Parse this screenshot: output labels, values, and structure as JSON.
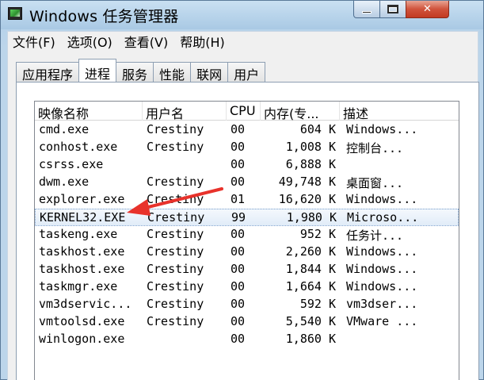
{
  "window": {
    "title": "Windows 任务管理器",
    "controls": {
      "minimize": "",
      "maximize": "",
      "close": "✕"
    }
  },
  "menu": [
    "文件(F)",
    "选项(O)",
    "查看(V)",
    "帮助(H)"
  ],
  "tabs": [
    {
      "label": "应用程序",
      "active": false
    },
    {
      "label": "进程",
      "active": true
    },
    {
      "label": "服务",
      "active": false
    },
    {
      "label": "性能",
      "active": false
    },
    {
      "label": "联网",
      "active": false
    },
    {
      "label": "用户",
      "active": false
    }
  ],
  "columns": [
    "映像名称",
    "用户名",
    "CPU",
    "内存(专...",
    "描述"
  ],
  "processes": [
    {
      "name": "cmd.exe",
      "user": "Crestiny",
      "cpu": "00",
      "mem": "604 K",
      "desc": "Windows..."
    },
    {
      "name": "conhost.exe",
      "user": "Crestiny",
      "cpu": "00",
      "mem": "1,008 K",
      "desc": "控制台..."
    },
    {
      "name": "csrss.exe",
      "user": "",
      "cpu": "00",
      "mem": "6,888 K",
      "desc": ""
    },
    {
      "name": "dwm.exe",
      "user": "Crestiny",
      "cpu": "00",
      "mem": "49,748 K",
      "desc": "桌面窗..."
    },
    {
      "name": "explorer.exe",
      "user": "Crestiny",
      "cpu": "01",
      "mem": "16,620 K",
      "desc": "Windows..."
    },
    {
      "name": "KERNEL32.EXE",
      "user": "Crestiny",
      "cpu": "99",
      "mem": "1,980 K",
      "desc": "Microso...",
      "selected": true
    },
    {
      "name": "taskeng.exe",
      "user": "Crestiny",
      "cpu": "00",
      "mem": "952 K",
      "desc": "任务计..."
    },
    {
      "name": "taskhost.exe",
      "user": "Crestiny",
      "cpu": "00",
      "mem": "2,260 K",
      "desc": "Windows..."
    },
    {
      "name": "taskhost.exe",
      "user": "Crestiny",
      "cpu": "00",
      "mem": "1,844 K",
      "desc": "Windows..."
    },
    {
      "name": "taskmgr.exe",
      "user": "Crestiny",
      "cpu": "00",
      "mem": "1,664 K",
      "desc": "Windows..."
    },
    {
      "name": "vm3dservic...",
      "user": "Crestiny",
      "cpu": "00",
      "mem": "592 K",
      "desc": "vm3dser..."
    },
    {
      "name": "vmtoolsd.exe",
      "user": "Crestiny",
      "cpu": "00",
      "mem": "5,540 K",
      "desc": "VMware ..."
    },
    {
      "name": "winlogon.exe",
      "user": "",
      "cpu": "00",
      "mem": "1,860 K",
      "desc": ""
    }
  ],
  "colors": {
    "annotation_arrow": "#e8322b",
    "selection_border": "#7da2ce"
  }
}
